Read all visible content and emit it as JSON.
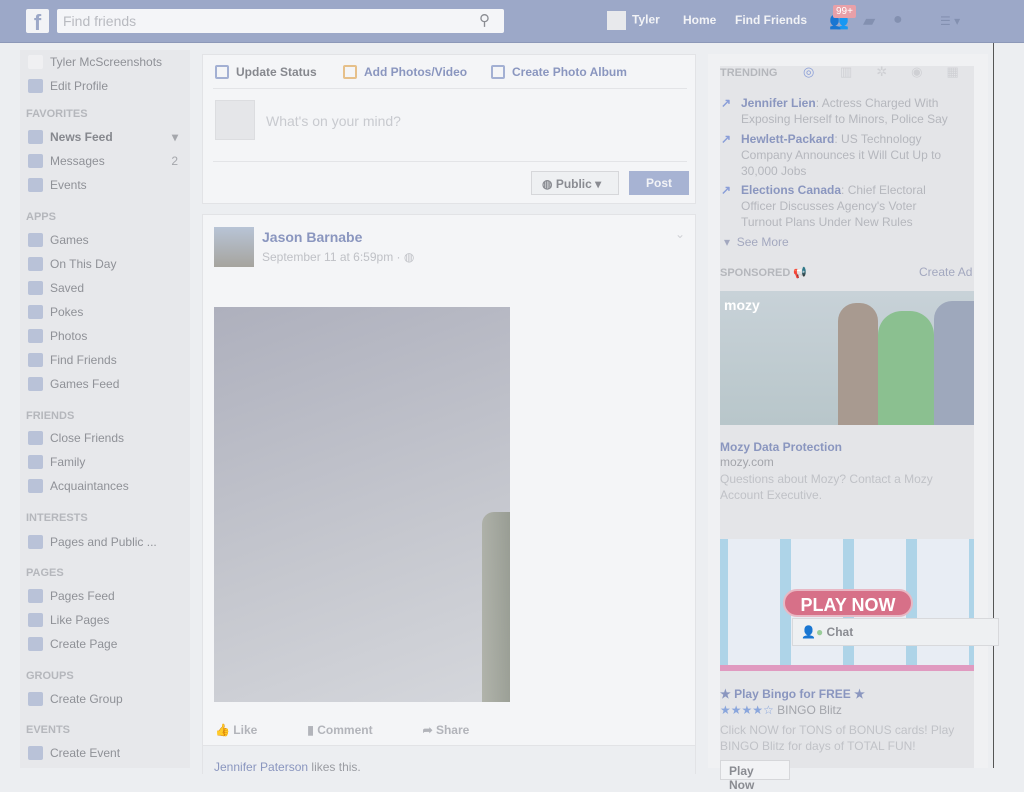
{
  "header": {
    "search_placeholder": "Find friends",
    "user": "Tyler",
    "home": "Home",
    "find_friends": "Find Friends",
    "notif_count": "99+"
  },
  "sidebar": {
    "profile": "Tyler McScreenshots",
    "edit_profile": "Edit Profile",
    "sections": [
      {
        "title": "FAVORITES",
        "items": [
          {
            "label": "News Feed",
            "count": ""
          },
          {
            "label": "Messages",
            "count": "2"
          },
          {
            "label": "Events",
            "count": ""
          }
        ]
      },
      {
        "title": "APPS",
        "items": [
          {
            "label": "Games"
          },
          {
            "label": "On This Day"
          },
          {
            "label": "Saved"
          },
          {
            "label": "Pokes"
          },
          {
            "label": "Photos"
          },
          {
            "label": "Find Friends"
          },
          {
            "label": "Games Feed"
          }
        ]
      },
      {
        "title": "FRIENDS",
        "items": [
          {
            "label": "Close Friends"
          },
          {
            "label": "Family"
          },
          {
            "label": "Acquaintances"
          }
        ]
      },
      {
        "title": "INTERESTS",
        "items": [
          {
            "label": "Pages and Public ..."
          }
        ]
      },
      {
        "title": "PAGES",
        "items": [
          {
            "label": "Pages Feed"
          },
          {
            "label": "Like Pages"
          },
          {
            "label": "Create Page"
          }
        ]
      },
      {
        "title": "GROUPS",
        "items": [
          {
            "label": "Create Group"
          }
        ]
      },
      {
        "title": "EVENTS",
        "items": [
          {
            "label": "Create Event"
          }
        ]
      }
    ]
  },
  "composer": {
    "tabs": [
      "Update Status",
      "Add Photos/Video",
      "Create Photo Album"
    ],
    "placeholder": "What's on your mind?",
    "privacy": "Public",
    "post": "Post"
  },
  "post": {
    "author": "Jason Barnabe",
    "time": "September 11 at 6:59pm ·",
    "actions": [
      "Like",
      "Comment",
      "Share"
    ],
    "liker": "Jennifer Paterson",
    "likes_suffix": " likes this."
  },
  "trending": {
    "title": "TRENDING",
    "items": [
      {
        "topic": "Jennifer Lien",
        "text": ": Actress Charged With Exposing Herself to Minors, Police Say"
      },
      {
        "topic": "Hewlett-Packard",
        "text": ": US Technology Company Announces it Will Cut Up to 30,000 Jobs"
      },
      {
        "topic": "Elections Canada",
        "text": ": Chief Electoral Officer Discusses Agency's Voter Turnout Plans Under New Rules"
      }
    ],
    "see_more": "See More"
  },
  "sponsored": {
    "title": "SPONSORED",
    "create_ad": "Create Ad",
    "ads": [
      {
        "brand": "mozy",
        "title": "Mozy Data Protection",
        "domain": "mozy.com",
        "text": "Questions about Mozy? Contact a Mozy Account Executive."
      },
      {
        "banner": "PLAY NOW",
        "title": "★ Play Bingo for FREE ★",
        "rating": 4.5,
        "source": "BINGO Blitz",
        "text": "Click NOW for TONS of BONUS cards! Play BINGO Blitz for days of TOTAL FUN!",
        "button": "Play Now"
      }
    ]
  },
  "chat": {
    "label": "Chat"
  }
}
